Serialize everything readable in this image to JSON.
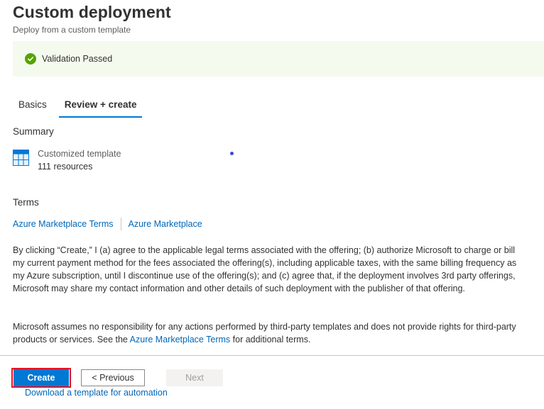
{
  "header": {
    "title": "Custom deployment",
    "subtitle": "Deploy from a custom template"
  },
  "validation": {
    "icon": "check-circle-icon",
    "text": "Validation Passed",
    "color": "#57a300",
    "background": "#f4fbee"
  },
  "tabs": [
    {
      "label": "Basics",
      "active": false
    },
    {
      "label": "Review + create",
      "active": true
    }
  ],
  "summary": {
    "heading": "Summary",
    "item": {
      "icon": "template-grid-icon",
      "title": "Customized template",
      "detail": "111 resources"
    }
  },
  "terms": {
    "heading": "Terms",
    "links": [
      "Azure Marketplace Terms",
      "Azure Marketplace"
    ],
    "paragraph1": "By clicking “Create,” I (a) agree to the applicable legal terms associated with the offering; (b) authorize Microsoft to charge or bill my current payment method for the fees associated the offering(s), including applicable taxes, with the same billing frequency as my Azure subscription, until I discontinue use of the offering(s); and (c) agree that, if the deployment involves 3rd party offerings, Microsoft may share my contact information and other details of such deployment with the publisher of that offering.",
    "paragraph2_before": "Microsoft assumes no responsibility for any actions performed by third-party templates and does not provide rights for third-party products or services. See the ",
    "paragraph2_link": "Azure Marketplace Terms",
    "paragraph2_after": " for additional terms."
  },
  "footer": {
    "create_label": "Create",
    "previous_label": "< Previous",
    "next_label": "Next",
    "download_link": "Download a template for automation"
  },
  "colors": {
    "accent": "#0078d4",
    "link": "#0067b8",
    "highlight_outline": "#e81123"
  }
}
